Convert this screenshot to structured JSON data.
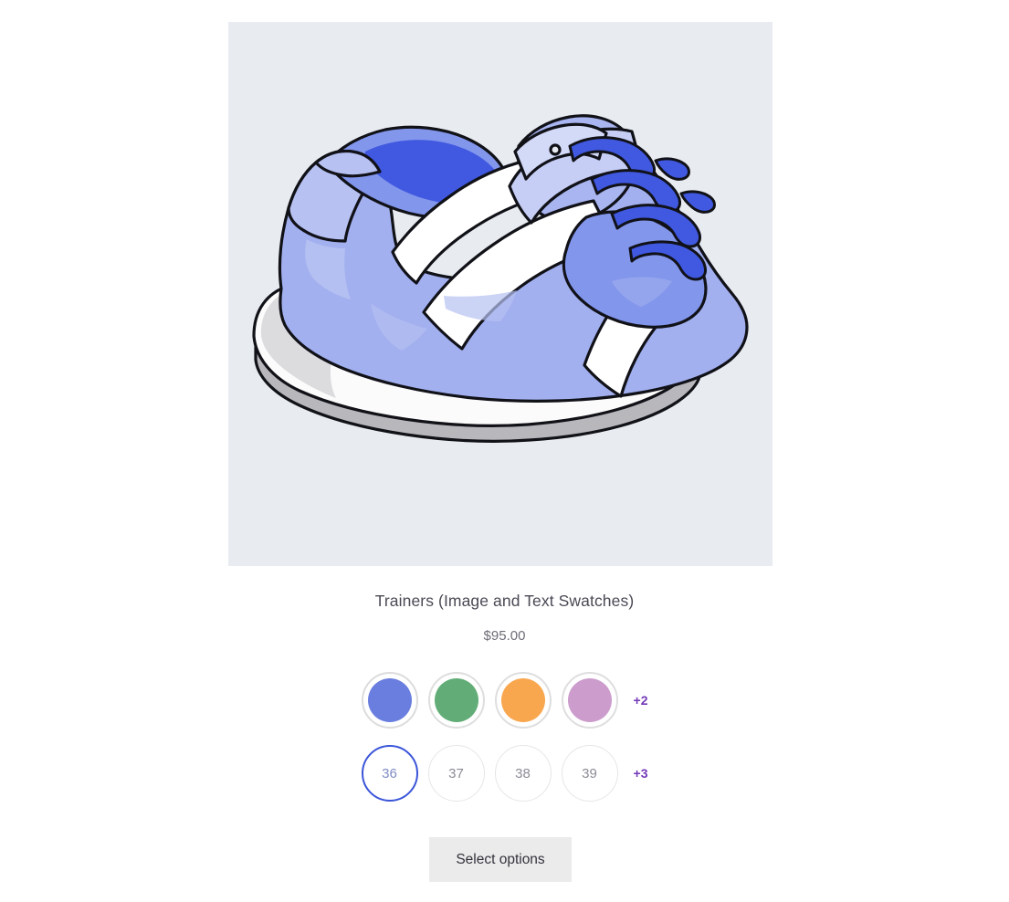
{
  "product": {
    "title": "Trainers (Image and Text Swatches)",
    "price": "$95.00",
    "image_alt": "sneaker-illustration",
    "image_background": "#e8ecf1"
  },
  "colors": {
    "more_label": "+2",
    "options": [
      {
        "name": "blue",
        "hex": "#6a7ee0",
        "selected": true
      },
      {
        "name": "green",
        "hex": "#62ad77",
        "selected": false
      },
      {
        "name": "orange",
        "hex": "#f9a74f",
        "selected": false
      },
      {
        "name": "pink",
        "hex": "#cc9dcc",
        "selected": false
      }
    ]
  },
  "sizes": {
    "more_label": "+3",
    "options": [
      {
        "label": "36",
        "selected": true
      },
      {
        "label": "37",
        "selected": false
      },
      {
        "label": "38",
        "selected": false
      },
      {
        "label": "39",
        "selected": false
      }
    ]
  },
  "actions": {
    "select_options_label": "Select options"
  },
  "theme": {
    "accent_purple": "#7339b8",
    "accent_blue": "#3b55d9",
    "button_bg": "#ebebeb",
    "page_bg": "#ffffff"
  }
}
